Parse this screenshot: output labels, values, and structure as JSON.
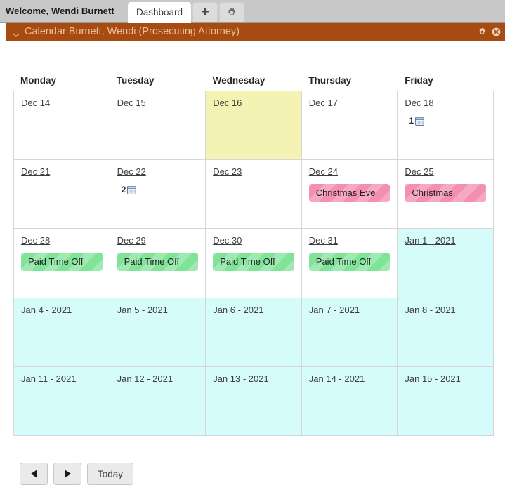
{
  "topbar": {
    "welcome": "Welcome, Wendi Burnett",
    "tab_label": "Dashboard",
    "add_tab_label": "+",
    "settings_icon": "gear-icon"
  },
  "portlet": {
    "title": "Calendar Burnett, Wendi (Prosecuting Attorney)",
    "collapse_icon": "chevron-down-icon",
    "settings_icon": "gear-icon",
    "close_icon": "close-circle-icon",
    "header_color": "#a84b10",
    "title_color": "#e9bfa2"
  },
  "calendar": {
    "day_headers": [
      "Monday",
      "Tuesday",
      "Wednesday",
      "Thursday",
      "Friday"
    ],
    "today_color": "#f4f3b4",
    "future_color": "#d6fbfb",
    "event_pink_color": "#f48fb4",
    "event_green_color": "#7fe398",
    "weeks": [
      [
        {
          "date": "Dec 14",
          "state": "normal",
          "events": [],
          "count": null
        },
        {
          "date": "Dec 15",
          "state": "normal",
          "events": [],
          "count": null
        },
        {
          "date": "Dec 16",
          "state": "today",
          "events": [],
          "count": null
        },
        {
          "date": "Dec 17",
          "state": "normal",
          "events": [],
          "count": null
        },
        {
          "date": "Dec 18",
          "state": "normal",
          "events": [],
          "count": "1"
        }
      ],
      [
        {
          "date": "Dec 21",
          "state": "normal",
          "events": [],
          "count": null
        },
        {
          "date": "Dec 22",
          "state": "normal",
          "events": [],
          "count": "2"
        },
        {
          "date": "Dec 23",
          "state": "normal",
          "events": [],
          "count": null
        },
        {
          "date": "Dec 24",
          "state": "normal",
          "events": [
            {
              "label": "Christmas Eve",
              "color": "pink"
            }
          ],
          "count": null
        },
        {
          "date": "Dec 25",
          "state": "normal",
          "events": [
            {
              "label": "Christmas",
              "color": "pink"
            }
          ],
          "count": null
        }
      ],
      [
        {
          "date": "Dec 28",
          "state": "normal",
          "events": [
            {
              "label": "Paid Time Off",
              "color": "green"
            }
          ],
          "count": null
        },
        {
          "date": "Dec 29",
          "state": "normal",
          "events": [
            {
              "label": "Paid Time Off",
              "color": "green"
            }
          ],
          "count": null
        },
        {
          "date": "Dec 30",
          "state": "normal",
          "events": [
            {
              "label": "Paid Time Off",
              "color": "green"
            }
          ],
          "count": null
        },
        {
          "date": "Dec 31",
          "state": "normal",
          "events": [
            {
              "label": "Paid Time Off",
              "color": "green"
            }
          ],
          "count": null
        },
        {
          "date": "Jan 1 - 2021",
          "state": "future",
          "events": [],
          "count": null
        }
      ],
      [
        {
          "date": "Jan 4 - 2021",
          "state": "future",
          "events": [],
          "count": null
        },
        {
          "date": "Jan 5 - 2021",
          "state": "future",
          "events": [],
          "count": null
        },
        {
          "date": "Jan 6 - 2021",
          "state": "future",
          "events": [],
          "count": null
        },
        {
          "date": "Jan 7 - 2021",
          "state": "future",
          "events": [],
          "count": null
        },
        {
          "date": "Jan 8 - 2021",
          "state": "future",
          "events": [],
          "count": null
        }
      ],
      [
        {
          "date": "Jan 11 - 2021",
          "state": "future",
          "events": [],
          "count": null
        },
        {
          "date": "Jan 12 - 2021",
          "state": "future",
          "events": [],
          "count": null
        },
        {
          "date": "Jan 13 - 2021",
          "state": "future",
          "events": [],
          "count": null
        },
        {
          "date": "Jan 14 - 2021",
          "state": "future",
          "events": [],
          "count": null
        },
        {
          "date": "Jan 15 - 2021",
          "state": "future",
          "events": [],
          "count": null
        }
      ]
    ]
  },
  "footer": {
    "prev_label": "",
    "next_label": "",
    "today_label": "Today"
  }
}
